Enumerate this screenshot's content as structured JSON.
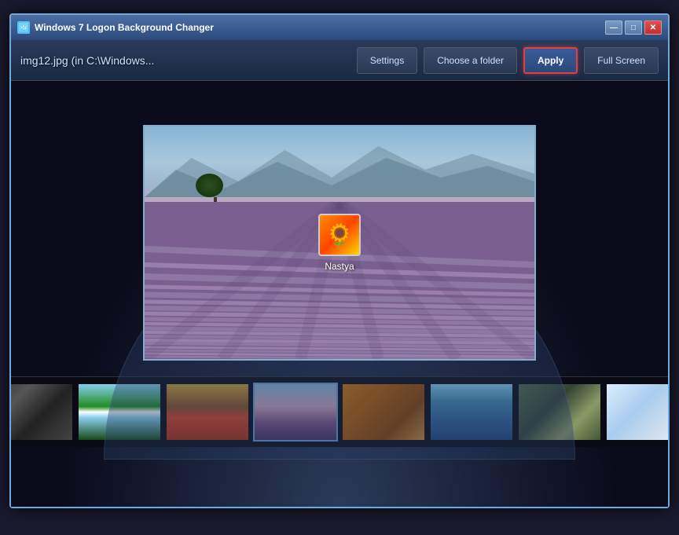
{
  "window": {
    "title": "Windows 7 Logon Background Changer",
    "icon": "🖼"
  },
  "title_bar": {
    "text": "Windows 7 Logon Background Changer",
    "controls": {
      "minimize": "—",
      "maximize": "□",
      "close": "✕"
    }
  },
  "toolbar": {
    "current_file": "img12.jpg (in C:\\Windows...",
    "settings_label": "Settings",
    "choose_folder_label": "Choose a folder",
    "apply_label": "Apply",
    "fullscreen_label": "Full Screen"
  },
  "preview": {
    "user_name": "Nastya",
    "user_avatar_emoji": "🌻"
  },
  "thumbnails": [
    {
      "id": 1,
      "class": "thumb-1",
      "selected": false
    },
    {
      "id": 2,
      "class": "thumb-2",
      "selected": false
    },
    {
      "id": 3,
      "class": "thumb-3",
      "selected": false
    },
    {
      "id": 4,
      "class": "thumb-4",
      "selected": true
    },
    {
      "id": 5,
      "class": "thumb-5",
      "selected": false
    },
    {
      "id": 6,
      "class": "thumb-6",
      "selected": false
    },
    {
      "id": 7,
      "class": "thumb-7",
      "selected": false
    },
    {
      "id": 8,
      "class": "thumb-8",
      "selected": false
    }
  ]
}
